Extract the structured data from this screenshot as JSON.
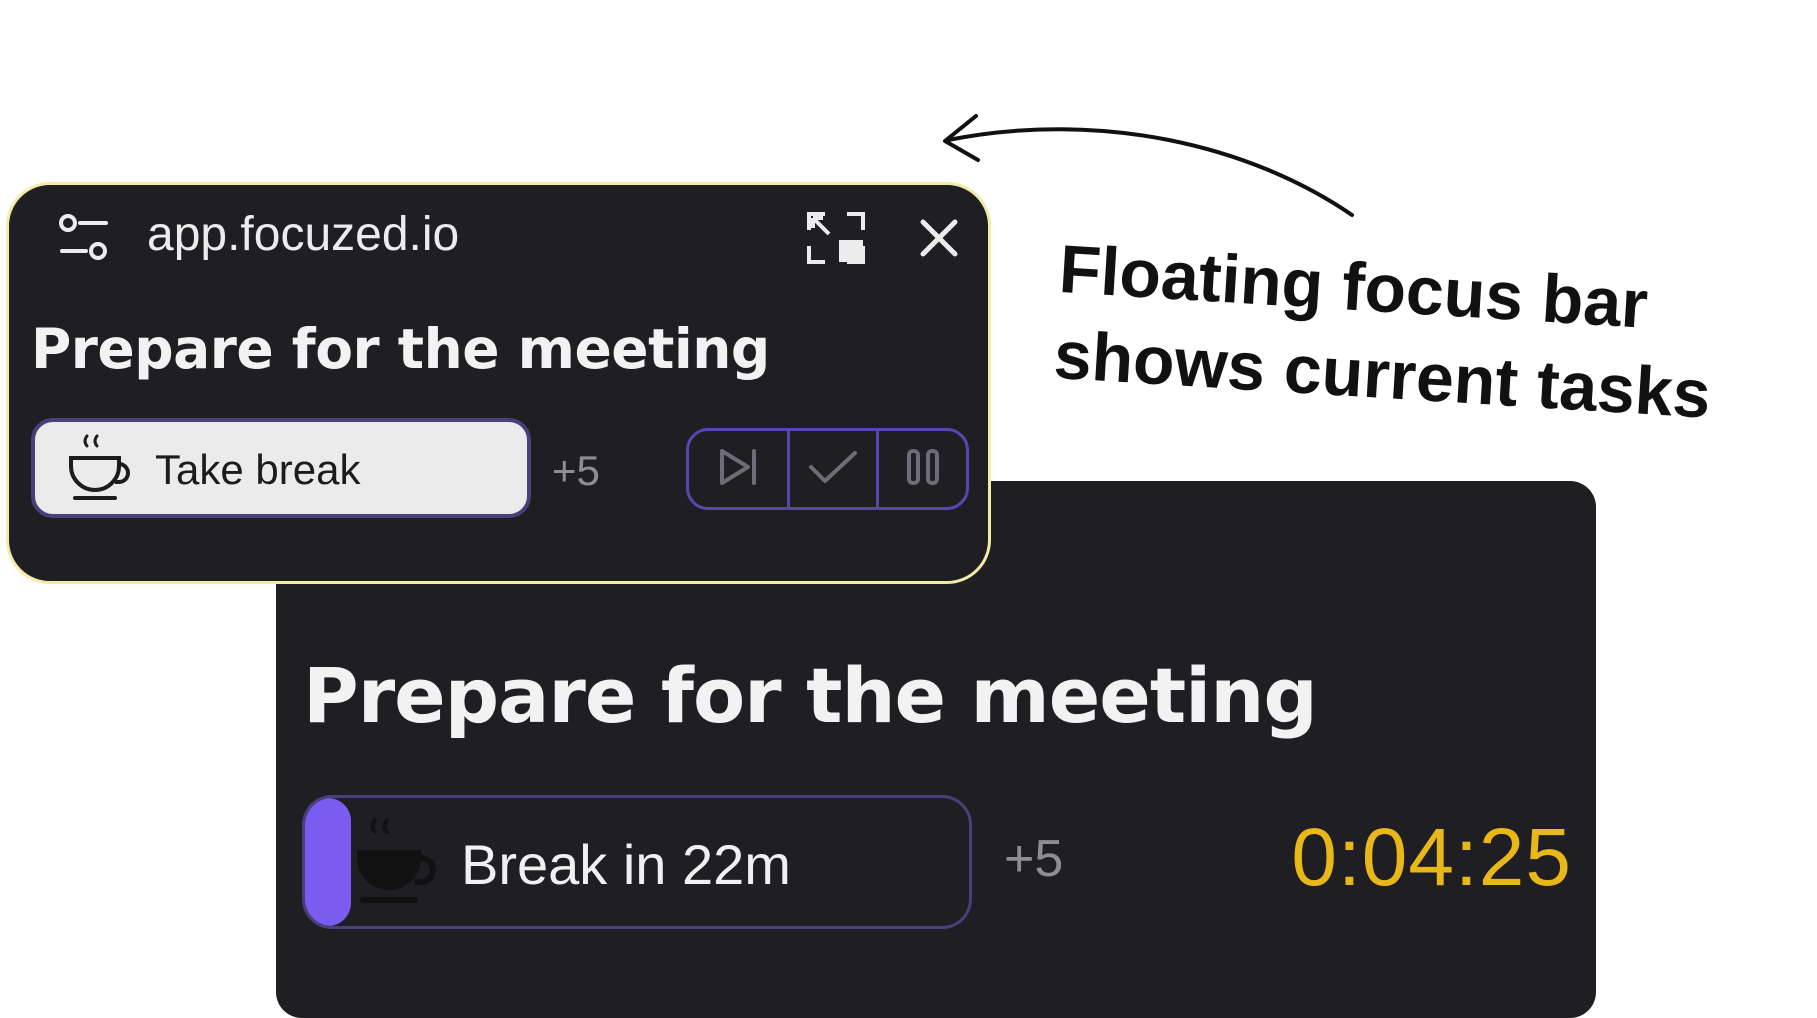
{
  "floating_bar": {
    "url": "app.focuzed.io",
    "task_title": "Prepare for the meeting",
    "take_break_label": "Take break",
    "extra_tasks": "+5",
    "border_color": "#f4eaa6",
    "controls": [
      "skip-next-icon",
      "check-icon",
      "pause-icon"
    ]
  },
  "main_view": {
    "task_title": "Prepare for the meeting",
    "break_label": "Break in  22m",
    "break_progress": 0.07,
    "extra_tasks": "+5",
    "timer": "0:04:25",
    "accent_color": "#7b5cf0",
    "timer_color": "#e8b818"
  },
  "annotation": {
    "line1": "Floating focus bar",
    "line2": "shows current tasks"
  }
}
